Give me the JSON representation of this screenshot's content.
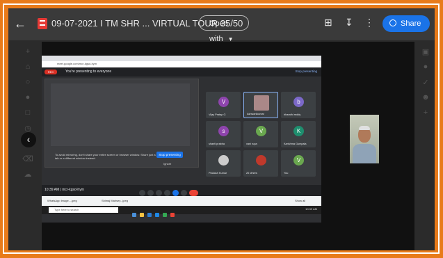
{
  "topbar": {
    "title": "09-07-2021 I TM SHR ... VIRTUAL TOUR 35/50",
    "open_with": "Open with",
    "share": "Share"
  },
  "meet": {
    "url": "meet.google.com/mcr-kgsd-hym",
    "presenting_msg": "You're presenting to everyone",
    "stop_presenting_top": "Stop presenting",
    "rec": "REC",
    "mirror_text": "To avoid mirroring, don't share your entire screen or browser window. Share just a tab or a different window instead.",
    "stop_presenting": "Stop presenting",
    "ignore": "Ignore",
    "clock": "10:39 AM | mcr-kgsd-hym",
    "participants": [
      {
        "initial": "V",
        "name": "Vijay Pratap G",
        "color": "#8e44ad"
      },
      {
        "initial": "",
        "name": "Ashwanikumar",
        "color": "#777"
      },
      {
        "initial": "b",
        "name": "bharathi reddy",
        "color": "#7b68c8"
      },
      {
        "initial": "s",
        "name": "shanti prabha",
        "color": "#8e44ad"
      },
      {
        "initial": "V",
        "name": "vani rupa",
        "color": "#6aa84f"
      },
      {
        "initial": "K",
        "name": "Karishma Gumpala",
        "color": "#1e8e6e"
      },
      {
        "initial": "",
        "name": "Prakash Kumar",
        "color": "#888"
      },
      {
        "initial": "",
        "name": "20 others",
        "color": "#c0392b"
      },
      {
        "initial": "V",
        "name": "You",
        "color": "#6aa84f"
      }
    ],
    "downloads": [
      "WhatsApp Image....jpeg",
      "Shimaj Marisey...jpeg"
    ],
    "show_all": "Show all",
    "taskbar_search": "Type here to search",
    "tray_time": "10:39 AM",
    "tray_date": "7/9/2021"
  }
}
